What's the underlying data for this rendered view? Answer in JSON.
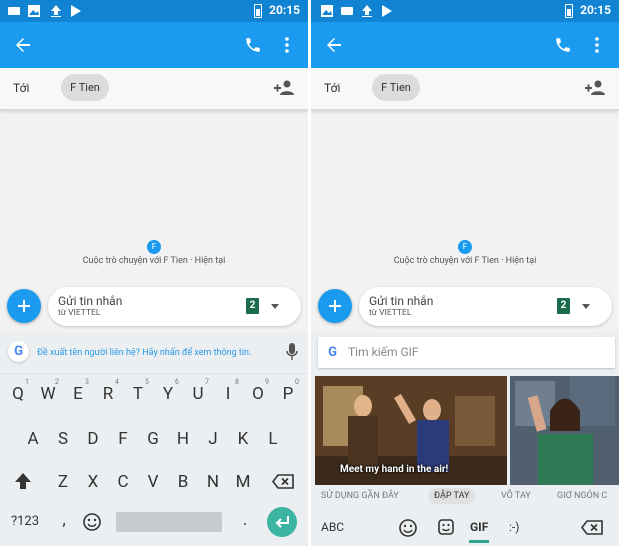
{
  "status": {
    "time": "20:15"
  },
  "header": {
    "to_label": "Tới",
    "contact_chip": "F Tien"
  },
  "conversation": {
    "avatar_letter": "F",
    "info_text": "Cuộc trò chuyện với F Tien · Hiện tại"
  },
  "compose": {
    "placeholder": "Gửi tin nhắn",
    "carrier": "từ VIETTEL",
    "sim_number": "2"
  },
  "keyboard": {
    "suggestion": "Đề xuất tên người liên hệ? Hãy nhấn để xem thông tin.",
    "row1": [
      {
        "k": "Q",
        "s": "1"
      },
      {
        "k": "W",
        "s": "2"
      },
      {
        "k": "E",
        "s": "3"
      },
      {
        "k": "R",
        "s": "4"
      },
      {
        "k": "T",
        "s": "5"
      },
      {
        "k": "Y",
        "s": "6"
      },
      {
        "k": "U",
        "s": "7"
      },
      {
        "k": "I",
        "s": "8"
      },
      {
        "k": "O",
        "s": "9"
      },
      {
        "k": "P",
        "s": "0"
      }
    ],
    "row2": [
      "A",
      "S",
      "D",
      "F",
      "G",
      "H",
      "J",
      "K",
      "L"
    ],
    "row3": [
      "Z",
      "X",
      "C",
      "V",
      "B",
      "N",
      "M"
    ],
    "symbols_key": "?123",
    "comma_key": ",",
    "period_key": "."
  },
  "gif_panel": {
    "search_placeholder": "Tìm kiếm GIF",
    "gif_caption": "Meet my hand in the air!",
    "categories": [
      "SỬ DỤNG GẦN ĐÂY",
      "ĐẬP TAY",
      "VỖ TAY",
      "GIƠ NGÓN C"
    ],
    "active_category": "ĐẬP TAY",
    "abc_label": "ABC",
    "gif_label": "GIF",
    "emoticon_label": ":-)"
  },
  "colors": {
    "status_bar": "#1183d3",
    "app_bar": "#1a9bf0",
    "accent": "#2fa48e",
    "sim": "#1b6b4c"
  }
}
